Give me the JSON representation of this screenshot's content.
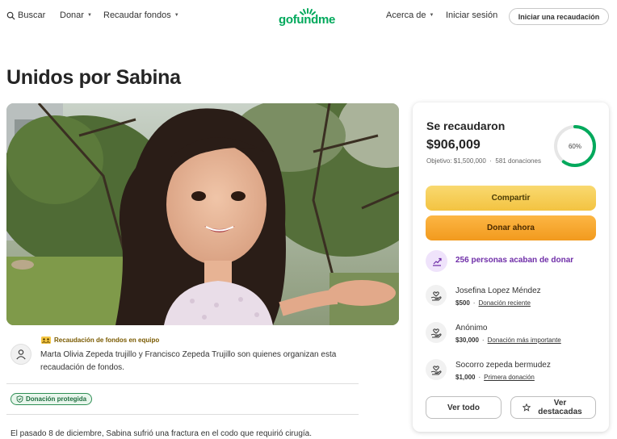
{
  "header": {
    "search_label": "Buscar",
    "donate_label": "Donar",
    "fundraise_label": "Recaudar fondos",
    "logo_text": "gofundme",
    "about_label": "Acerca de",
    "login_label": "Iniciar sesión",
    "start_label": "Iniciar una recaudación"
  },
  "page": {
    "title": "Unidos por Sabina"
  },
  "organizer": {
    "team_label": "Recaudación de fondos en equipo",
    "text": "Marta Olivia Zepeda trujillo y Francisco Zepeda Trujillo son quienes organizan esta recaudación de fondos.",
    "protected_label": "Donación protegida"
  },
  "story": {
    "first_line": "El pasado 8 de diciembre, Sabina sufrió una fractura en el codo que requirió cirugía."
  },
  "card": {
    "raised_label": "Se recaudaron",
    "raised_amount": "$906,009",
    "goal_text": "Objetivo: $1,500,000",
    "donations_count": "581",
    "donations_word": "donaciones",
    "percent_label": "60%",
    "progress": 0.6,
    "share_label": "Compartir",
    "donate_now_label": "Donar ahora",
    "recent_count_text": "256 personas acaban de donar",
    "donors": [
      {
        "name": "Josefina Lopez Méndez",
        "amount": "$500",
        "tag": "Donación reciente"
      },
      {
        "name": "Anónimo",
        "amount": "$30,000",
        "tag": "Donación más importante"
      },
      {
        "name": "Socorro zepeda bermudez",
        "amount": "$1,000",
        "tag": "Primera donación"
      }
    ],
    "see_all_label": "Ver todo",
    "see_top_label": "Ver destacadas"
  },
  "colors": {
    "brand_green": "#02a95c",
    "share_yellow": "#f6cd56",
    "donate_orange": "#f7a733",
    "trend_purple": "#6f2ea8"
  },
  "icons": [
    "search-icon",
    "caret-down-icon",
    "user-icon",
    "team-badge-icon",
    "shield-icon",
    "trend-up-icon",
    "heart-hand-icon",
    "star-icon"
  ]
}
